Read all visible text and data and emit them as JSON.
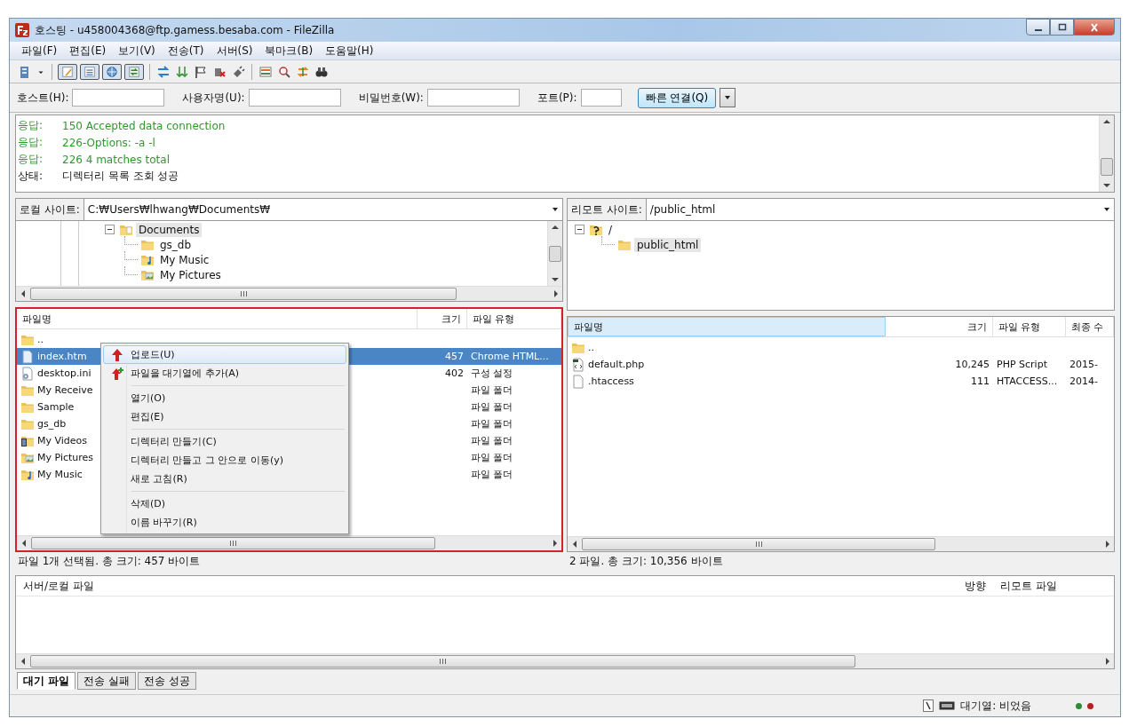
{
  "window": {
    "title": "호스팅 - u458004368@ftp.gamess.besaba.com - FileZilla"
  },
  "menu": [
    "파일(F)",
    "편집(E)",
    "보기(V)",
    "전송(T)",
    "서버(S)",
    "북마크(B)",
    "도움말(H)"
  ],
  "toolbar": [
    {
      "kind": "servers",
      "pressed": false
    },
    {
      "kind": "dropdown",
      "pressed": false
    },
    {
      "kind": "separator"
    },
    {
      "kind": "log",
      "pressed": true
    },
    {
      "kind": "local-tree",
      "pressed": true
    },
    {
      "kind": "remote-tree",
      "pressed": true
    },
    {
      "kind": "queue",
      "pressed": true
    },
    {
      "kind": "separator"
    },
    {
      "kind": "refresh",
      "pressed": false
    },
    {
      "kind": "process",
      "pressed": false
    },
    {
      "kind": "cancel",
      "pressed": false
    },
    {
      "kind": "disconnect",
      "pressed": false
    },
    {
      "kind": "reconnect",
      "pressed": false
    },
    {
      "kind": "separator"
    },
    {
      "kind": "filter",
      "pressed": false
    },
    {
      "kind": "compare",
      "pressed": false
    },
    {
      "kind": "sync",
      "pressed": false
    },
    {
      "kind": "find",
      "pressed": false
    }
  ],
  "quickconnect": {
    "fields": [
      {
        "label": "호스트(H):"
      },
      {
        "label": "사용자명(U):"
      },
      {
        "label": "비밀번호(W):"
      },
      {
        "label": "포트(P):"
      }
    ],
    "button": "빠른 연결(Q)"
  },
  "log": [
    {
      "prefix": "응답:",
      "text": "150 Accepted data connection",
      "kind": "response"
    },
    {
      "prefix": "응답:",
      "text": "226-Options: -a -l",
      "kind": "response"
    },
    {
      "prefix": "응답:",
      "text": "226 4 matches total",
      "kind": "response"
    },
    {
      "prefix": "상태:",
      "text": "디렉터리 목록 조회 성공",
      "kind": "status"
    }
  ],
  "local": {
    "site_label": "로컬 사이트:",
    "path": "C:₩Users₩lhwang₩Documents₩",
    "tree": [
      {
        "label": "Documents",
        "kind": "documents",
        "expanded": true,
        "selected": true,
        "children": [
          {
            "label": "gs_db",
            "kind": "folder",
            "selected": false
          },
          {
            "label": "My Music",
            "kind": "music",
            "selected": false
          },
          {
            "label": "My Pictures",
            "kind": "pictures",
            "selected": false
          }
        ]
      }
    ],
    "columns": [
      {
        "label": "파일명",
        "sorted": false
      },
      {
        "label": "크기",
        "sorted": false
      },
      {
        "label": "파일 유형",
        "sorted": false
      }
    ],
    "rows": [
      {
        "name": "..",
        "kind": "folder",
        "selected": false
      },
      {
        "name": "index.htm",
        "size": "457",
        "type": "Chrome HTML...",
        "kind": "html",
        "selected": true
      },
      {
        "name": "desktop.ini",
        "size": "402",
        "type": "구성 설정",
        "kind": "ini",
        "selected": false
      },
      {
        "name": "My Receive",
        "type": "파일 폴더",
        "kind": "folder",
        "selected": false
      },
      {
        "name": "Sample",
        "type": "파일 폴더",
        "kind": "folder",
        "selected": false
      },
      {
        "name": "gs_db",
        "type": "파일 폴더",
        "kind": "folder",
        "selected": false
      },
      {
        "name": "My Videos",
        "type": "파일 폴더",
        "kind": "videos",
        "selected": false
      },
      {
        "name": "My Pictures",
        "type": "파일 폴더",
        "kind": "pictures",
        "selected": false
      },
      {
        "name": "My Music",
        "type": "파일 폴더",
        "kind": "music",
        "selected": false
      }
    ],
    "status": "파일 1개 선택됨. 총 크기: 457 바이트"
  },
  "context_menu": [
    {
      "label": "업로드(U)",
      "kind": "upload",
      "selected": true
    },
    {
      "label": "파일을 대기열에 추가(A)",
      "kind": "queue-add",
      "selected": false
    },
    {
      "kind": "separator"
    },
    {
      "label": "열기(O)",
      "kind": "plain",
      "selected": false
    },
    {
      "label": "편집(E)",
      "kind": "plain",
      "selected": false
    },
    {
      "kind": "separator"
    },
    {
      "label": "디렉터리 만들기(C)",
      "kind": "plain",
      "selected": false
    },
    {
      "label": "디렉터리 만들고 그 안으로 이동(y)",
      "kind": "plain",
      "selected": false
    },
    {
      "label": "새로 고침(R)",
      "kind": "plain",
      "selected": false
    },
    {
      "kind": "separator"
    },
    {
      "label": "삭제(D)",
      "kind": "plain",
      "selected": false
    },
    {
      "label": "이름 바꾸기(R)",
      "kind": "plain",
      "selected": false
    }
  ],
  "remote": {
    "site_label": "리모트 사이트:",
    "path": "/public_html",
    "tree": [
      {
        "label": "/",
        "kind": "unknown",
        "expanded": true,
        "selected": false,
        "children": [
          {
            "label": "public_html",
            "kind": "folder",
            "selected": true
          }
        ]
      }
    ],
    "columns": [
      {
        "label": "파일명",
        "sorted": true
      },
      {
        "label": "크기",
        "sorted": false
      },
      {
        "label": "파일 유형",
        "sorted": false
      },
      {
        "label": "최종 수",
        "sorted": false
      }
    ],
    "rows": [
      {
        "name": "..",
        "kind": "folder",
        "selected": false
      },
      {
        "name": "default.php",
        "size": "10,245",
        "type": "PHP Script",
        "date": "2015-",
        "kind": "php",
        "selected": false
      },
      {
        "name": ".htaccess",
        "size": "111",
        "type": "HTACCESS...",
        "date": "2014-",
        "kind": "plain",
        "selected": false
      }
    ],
    "status": "2 파일. 총 크기: 10,356 바이트"
  },
  "queue": {
    "columns": [
      "서버/로컬 파일",
      "방향",
      "리모트 파일"
    ]
  },
  "tabs": [
    {
      "label": "대기 파일",
      "selected": true
    },
    {
      "label": "전송 실패",
      "selected": false
    },
    {
      "label": "전송 성공",
      "selected": false
    }
  ],
  "status_bar": {
    "text": "대기열: 비었음",
    "lights": [
      {
        "color": "#2e8b3a"
      },
      {
        "color": "#b3201e"
      }
    ]
  }
}
